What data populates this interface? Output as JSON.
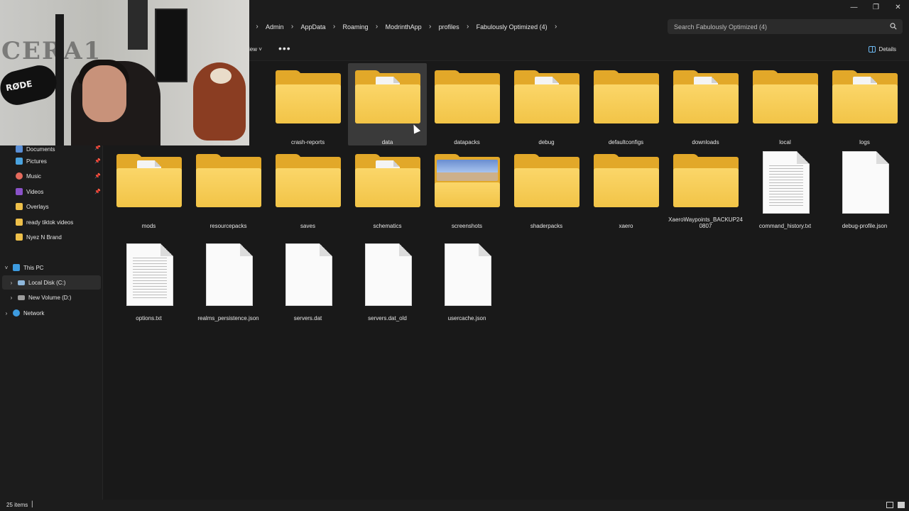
{
  "window": {
    "minimize_label": "—",
    "maximize_label": "❐",
    "close_label": "✕"
  },
  "breadcrumb": [
    "Admin",
    "AppData",
    "Roaming",
    "ModrinthApp",
    "profiles",
    "Fabulously Optimized (4)"
  ],
  "search": {
    "placeholder": "Search Fabulously Optimized (4)"
  },
  "commandbar": {
    "view_label": "iew",
    "more_label": "•••",
    "details_label": "Details"
  },
  "sidebar": {
    "quick_access": [
      {
        "label": "Documents",
        "icon": "documents-icon",
        "pinned": true
      },
      {
        "label": "Pictures",
        "icon": "pictures-icon",
        "pinned": true
      },
      {
        "label": "Music",
        "icon": "music-icon",
        "pinned": true
      },
      {
        "label": "Videos",
        "icon": "videos-icon",
        "pinned": true
      },
      {
        "label": "Overlays",
        "icon": "folder-icon",
        "pinned": false
      },
      {
        "label": "ready tiktok videos",
        "icon": "folder-icon",
        "pinned": false
      },
      {
        "label": "Nyez N Brand",
        "icon": "folder-icon",
        "pinned": false
      }
    ],
    "this_pc": "This PC",
    "local_disk": "Local Disk (C:)",
    "new_volume": "New Volume (D:)",
    "network": "Network"
  },
  "items": [
    {
      "name": "",
      "type": "folder",
      "partial": true
    },
    {
      "name": "crash-reports",
      "type": "folder"
    },
    {
      "name": "data",
      "type": "folder-doc",
      "selected": true
    },
    {
      "name": "datapacks",
      "type": "folder"
    },
    {
      "name": "debug",
      "type": "folder-doc"
    },
    {
      "name": "defaultconfigs",
      "type": "folder"
    },
    {
      "name": "downloads",
      "type": "folder-doc"
    },
    {
      "name": "local",
      "type": "folder"
    },
    {
      "name": "logs",
      "type": "folder-doc"
    },
    {
      "name": "mods",
      "type": "folder-doc"
    },
    {
      "name": "resourcepacks",
      "type": "folder"
    },
    {
      "name": "saves",
      "type": "folder"
    },
    {
      "name": "schematics",
      "type": "folder-doc"
    },
    {
      "name": "screenshots",
      "type": "folder-photo"
    },
    {
      "name": "shaderpacks",
      "type": "folder"
    },
    {
      "name": "xaero",
      "type": "folder"
    },
    {
      "name": "XaeroWaypoints_BACKUP240807",
      "type": "folder"
    },
    {
      "name": "command_history.txt",
      "type": "text-file"
    },
    {
      "name": "debug-profile.json",
      "type": "file"
    },
    {
      "name": "options.txt",
      "type": "text-file"
    },
    {
      "name": "realms_persistence.json",
      "type": "file"
    },
    {
      "name": "servers.dat",
      "type": "file"
    },
    {
      "name": "servers.dat_old",
      "type": "file"
    },
    {
      "name": "usercache.json",
      "type": "file"
    }
  ],
  "status": {
    "count": "25 items",
    "caret": "|"
  },
  "webcam": {
    "mic_brand": "RØDE",
    "wall_text": "CERA1"
  },
  "colors": {
    "background": "#191919",
    "folder_back": "#e2a829",
    "folder_front": "#f2c447",
    "selection": "#3a3a3a",
    "accent": "#6cb8f0"
  }
}
